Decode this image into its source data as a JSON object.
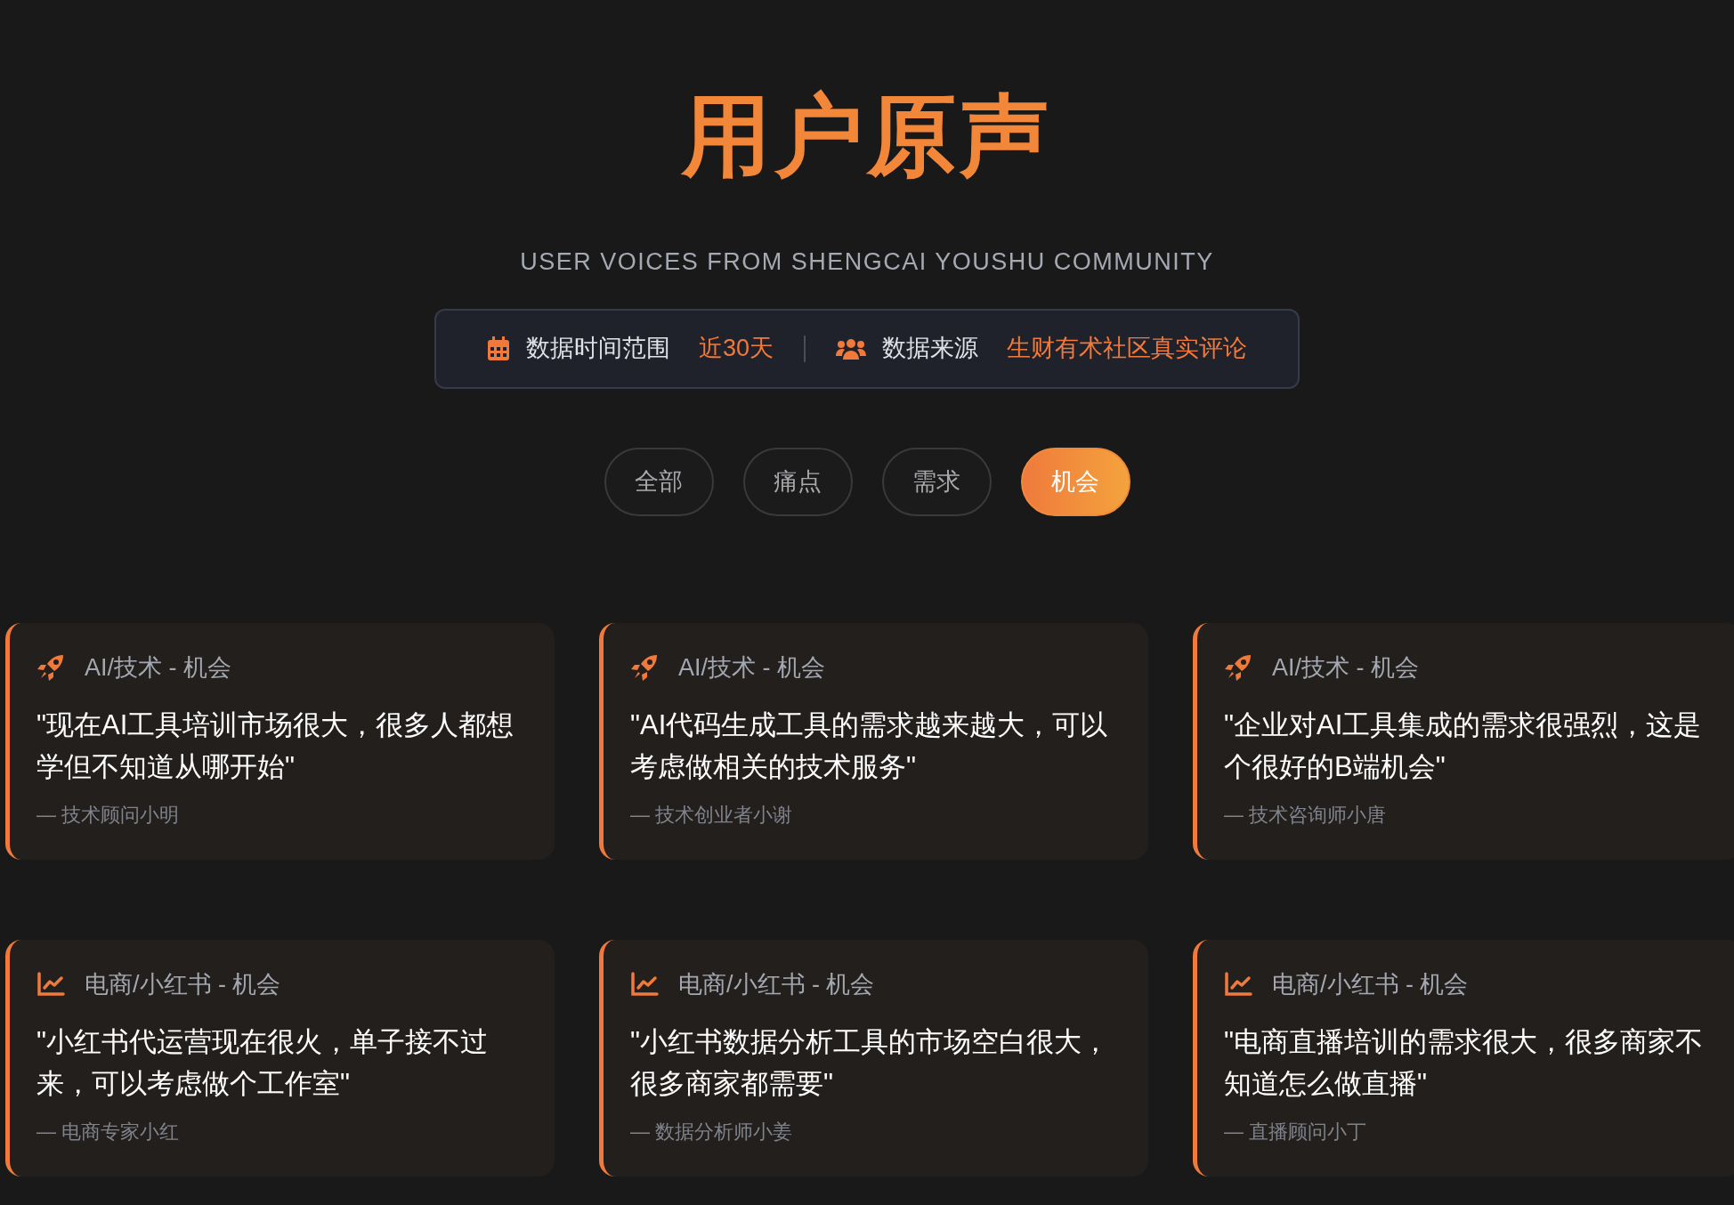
{
  "header": {
    "title": "用户原声",
    "subtitle": "USER VOICES FROM SHENGCAI YOUSHU COMMUNITY"
  },
  "info_bar": [
    {
      "kind": "range",
      "label": "数据时间范围",
      "value": "近30天"
    },
    {
      "kind": "source",
      "label": "数据来源",
      "value": "生财有术社区真实评论"
    }
  ],
  "filters": [
    {
      "label": "全部",
      "selected": false
    },
    {
      "label": "痛点",
      "selected": false
    },
    {
      "label": "需求",
      "selected": false
    },
    {
      "label": "机会",
      "selected": true
    }
  ],
  "cards": [
    {
      "kind": "tech",
      "category": "AI/技术 - 机会",
      "quote": "\"现在AI工具培训市场很大，很多人都想学但不知道从哪开始\"",
      "author": "— 技术顾问小明"
    },
    {
      "kind": "tech",
      "category": "AI/技术 - 机会",
      "quote": "\"AI代码生成工具的需求越来越大，可以考虑做相关的技术服务\"",
      "author": "— 技术创业者小谢"
    },
    {
      "kind": "tech",
      "category": "AI/技术 - 机会",
      "quote": "\"企业对AI工具集成的需求很强烈，这是个很好的B端机会\"",
      "author": "— 技术咨询师小唐"
    },
    {
      "kind": "commerce",
      "category": "电商/小红书 - 机会",
      "quote": "\"小红书代运营现在很火，单子接不过来，可以考虑做个工作室\"",
      "author": "— 电商专家小红"
    },
    {
      "kind": "commerce",
      "category": "电商/小红书 - 机会",
      "quote": "\"小红书数据分析工具的市场空白很大，很多商家都需要\"",
      "author": "— 数据分析师小姜"
    },
    {
      "kind": "commerce",
      "category": "电商/小红书 - 机会",
      "quote": "\"电商直播培训的需求很大，很多商家不知道怎么做直播\"",
      "author": "— 直播顾问小丁"
    }
  ]
}
